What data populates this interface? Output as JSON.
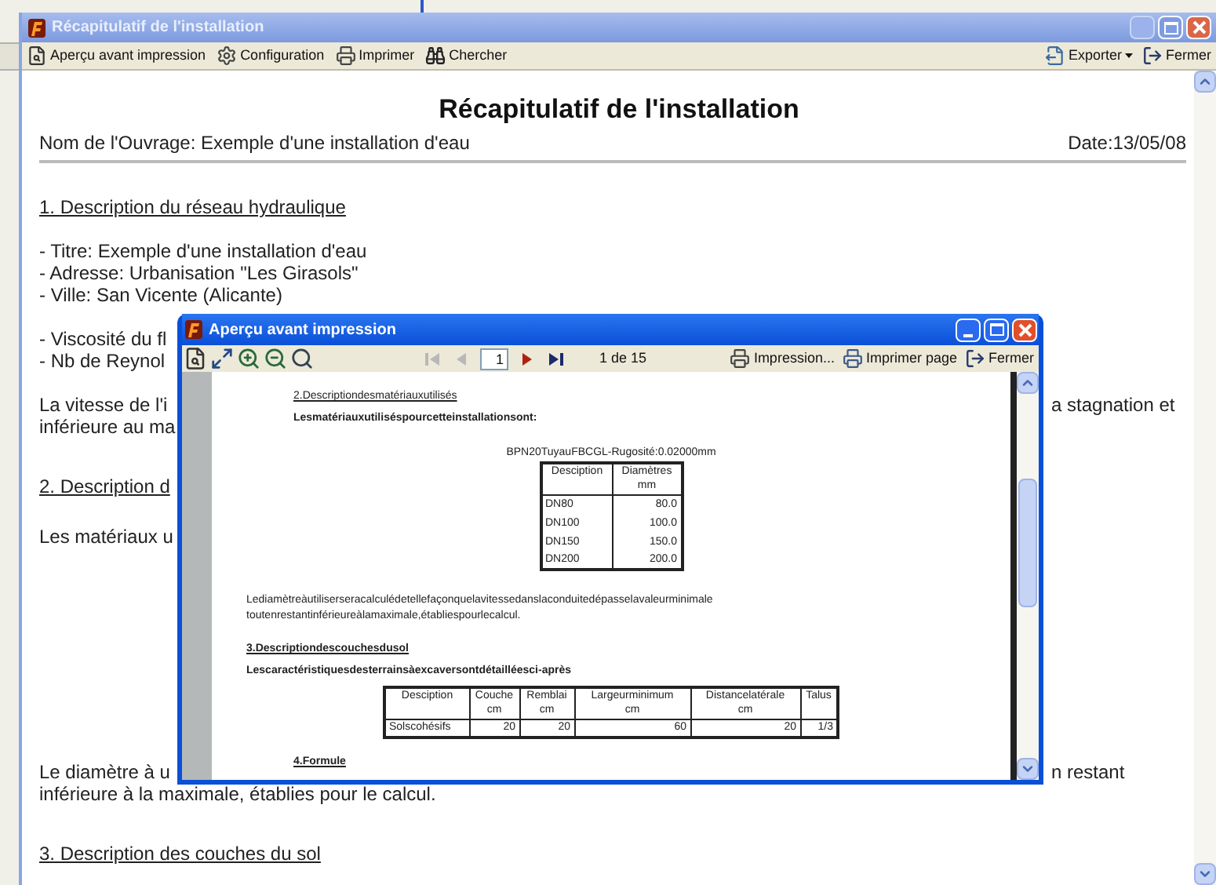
{
  "main_window": {
    "title": "Récapitulatif de l'installation",
    "toolbar": [
      {
        "kind": "preview",
        "label": "Aperçu avant impression"
      },
      {
        "kind": "settings",
        "label": "Configuration"
      },
      {
        "kind": "print",
        "label": "Imprimer"
      },
      {
        "kind": "find",
        "label": "Chercher"
      }
    ],
    "toolbar_right": [
      {
        "kind": "export",
        "label": "Exporter"
      },
      {
        "kind": "close",
        "label": "Fermer"
      }
    ],
    "document": {
      "title": "Récapitulatif de l'installation",
      "work_name": "Nom de l'Ouvrage: Exemple d'une installation d'eau",
      "date": "Date:13/05/08",
      "sections": [
        {
          "heading": "1. Description du réseau hydraulique",
          "paragraphs": [
            [
              {
                "text": "- Titre: Exemple d'une installation d'eau"
              },
              {
                "text": "- Adresse: Urbanisation \"Les Girasols\""
              },
              {
                "text": "- Ville: San Vicente (Alicante)"
              }
            ],
            [
              {
                "text": "- Viscosité du fl"
              },
              {
                "text": "- Nb de Reynol"
              }
            ],
            [
              {
                "text": "La vitesse de l'i",
                "right": "a stagnation et"
              },
              {
                "text": "inférieure au ma"
              }
            ]
          ]
        },
        {
          "heading": "2. Description d",
          "paragraphs": [
            [
              {
                "text": "Les matériaux u"
              }
            ],
            [
              {
                "text": "Le diamètre à u",
                "right": "n restant"
              },
              {
                "text": "inférieure à la maximale, établies pour le calcul."
              }
            ]
          ]
        },
        {
          "heading": "3. Description des couches du sol"
        }
      ]
    }
  },
  "preview_dialog": {
    "title": "Aperçu avant impression",
    "tools": [
      {
        "kind": "page-setup"
      },
      {
        "kind": "fit"
      },
      {
        "kind": "zoom-in"
      },
      {
        "kind": "zoom-out"
      },
      {
        "kind": "find"
      }
    ],
    "nav": [
      {
        "kind": "first",
        "disabled": true
      },
      {
        "kind": "prev",
        "disabled": true
      }
    ],
    "page_field": {
      "value": "1"
    },
    "nav_after": [
      {
        "kind": "next",
        "disabled": false
      },
      {
        "kind": "last",
        "disabled": false
      }
    ],
    "page_count": "1 de 15",
    "buttons": [
      {
        "kind": "print",
        "label": "Impression..."
      },
      {
        "kind": "print-page",
        "label": "Imprimer page"
      },
      {
        "kind": "close",
        "label": "Fermer"
      }
    ],
    "page": {
      "heading_2": "2.Descriptiondesmatériauxutilisés",
      "intro_2": "Lesmatériauxutiliséspourcetteinstallationsont:",
      "pipe_caption": "BPN20TuyauFBCGL-Rugosité:0.02000mm",
      "pipe_table": {
        "columns": [
          {
            "label": "Desciption"
          },
          {
            "label": "Diamètres",
            "unit": "mm"
          }
        ],
        "rows": [
          [
            "DN80",
            "80.0"
          ],
          [
            "DN100",
            "100.0"
          ],
          [
            "DN150",
            "150.0"
          ],
          [
            "DN200",
            "200.0"
          ]
        ]
      },
      "paragraph": [
        "Lediamètreàutiliserseracalculédetellefaçonquelavitessedanslaconduitedépasselavaleurminimale",
        "toutenrestantinférieureàlamaximale,établiespourlecalcul."
      ],
      "heading_3": "3.Descriptiondescouchesdusol",
      "intro_3": "Lescaractéristiquesdesterrainsàexcaversontdétailléesci-après",
      "soil_table": {
        "columns": [
          {
            "label": "Desciption"
          },
          {
            "label": "Couche",
            "unit": "cm"
          },
          {
            "label": "Remblai",
            "unit": "cm"
          },
          {
            "label": "Largeurminimum",
            "unit": "cm"
          },
          {
            "label": "Distancelatérale",
            "unit": "cm"
          },
          {
            "label": "Talus"
          }
        ],
        "rows": [
          [
            "Solscohésifs",
            "20",
            "20",
            "60",
            "20",
            "1/3"
          ]
        ]
      },
      "heading_4": "4.Formule"
    }
  }
}
